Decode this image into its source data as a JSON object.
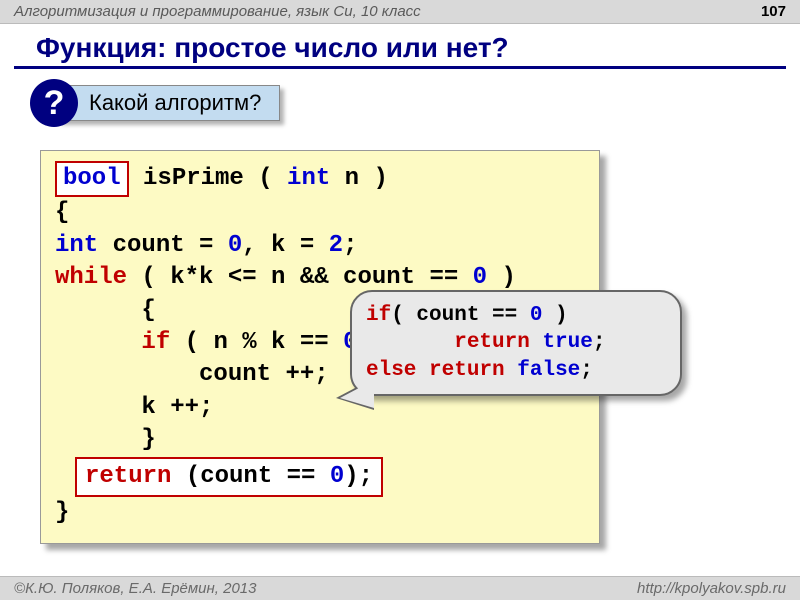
{
  "header": {
    "course": "Алгоритмизация и программирование, язык Си, 10 класс",
    "page": "107"
  },
  "title": "Функция: простое число или нет?",
  "question": {
    "mark": "?",
    "text": "Какой алгоритм?"
  },
  "code": {
    "bool_kw": "bool",
    "fn_name": " isPrime ( ",
    "int_kw": "int",
    "param_tail": " n )",
    "brace_open": "{",
    "decl_pre": "   ",
    "decl_int": "int",
    "decl_mid": " count = ",
    "zero1": "0",
    "decl_mid2": ",  k = ",
    "two": "2",
    "decl_end": ";",
    "while_pre": "   ",
    "while_kw": "while",
    "while_cond": " ( k*k  <= n && count == ",
    "zero2": "0",
    "while_cond_end": " )",
    "inner_open": "      {",
    "if_pre": "      ",
    "if_kw": "if",
    "if_cond": " ( n % k == ",
    "zero3": "0",
    "if_cond_end": " )",
    "countpp": "          count ++;",
    "kpp": "      k ++;",
    "inner_close": "      }",
    "return_kw": "return",
    "return_expr": " (count == ",
    "zero4": "0",
    "return_end": ");",
    "brace_close": "}"
  },
  "speech": {
    "if_kw": "if",
    "cond": "( count == ",
    "zero": "0",
    "cond_end": " )",
    "return1": "return",
    "true_kw": "true",
    "semi1": ";",
    "else_kw": "else",
    "return2": "return",
    "false_kw": "false",
    "semi2": ";"
  },
  "footer": {
    "left": "К.Ю. Поляков, Е.А. Ерёмин, 2013",
    "right": "http://kpolyakov.spb.ru"
  }
}
